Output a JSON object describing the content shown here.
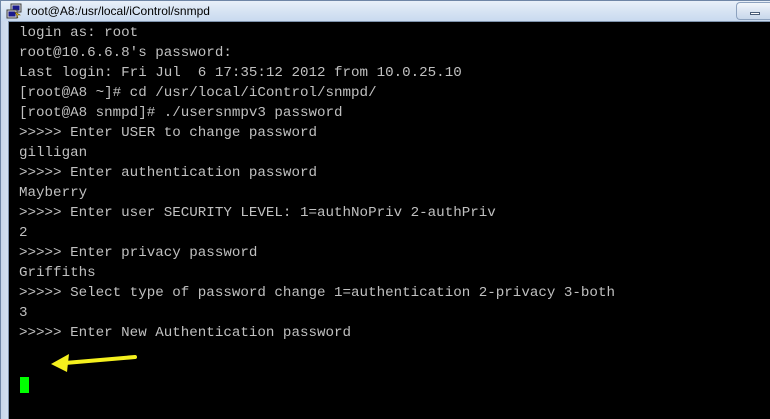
{
  "window": {
    "title": "root@A8:/usr/local/iControl/snmpd",
    "app_icon": "putty-icon",
    "minimize_icon": "minimize-icon"
  },
  "terminal": {
    "background_color": "#000000",
    "text_color": "#c0c0c0",
    "cursor_color": "#00ff00",
    "lines": [
      "login as: root",
      "root@10.6.6.8's password:",
      "Last login: Fri Jul  6 17:35:12 2012 from 10.0.25.10",
      "[root@A8 ~]# cd /usr/local/iControl/snmpd/",
      "[root@A8 snmpd]# ./usersnmpv3 password",
      ">>>>> Enter USER to change password",
      "gilligan",
      ">>>>> Enter authentication password",
      "Mayberry",
      ">>>>> Enter user SECURITY LEVEL: 1=authNoPriv 2-authPriv",
      "2",
      ">>>>> Enter privacy password",
      "Griffiths",
      ">>>>> Select type of password change 1=authentication 2-privacy 3-both",
      "3",
      ">>>>> Enter New Authentication password"
    ]
  },
  "annotation": {
    "arrow_icon": "arrow-left-icon",
    "arrow_color": "#f5f01e"
  }
}
